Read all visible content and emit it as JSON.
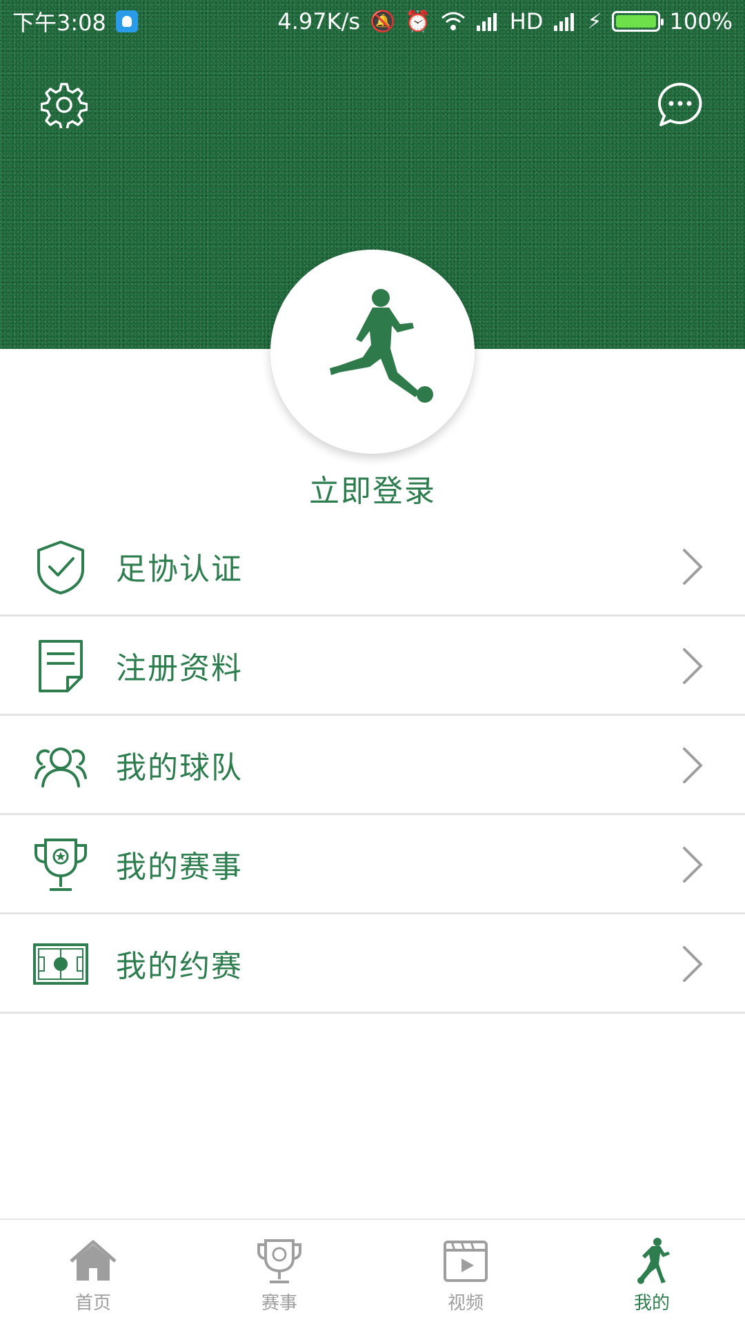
{
  "status_bar": {
    "time": "下午3:08",
    "net_speed": "4.97K/s",
    "network": "HD",
    "battery": "100%",
    "battery_level": 1.0
  },
  "header": {
    "settings_icon": "gear-icon",
    "message_icon": "chat-bubble-icon"
  },
  "profile": {
    "avatar_icon": "soccer-player-icon",
    "login_label": "立即登录"
  },
  "menu": {
    "items": [
      {
        "label": "足协认证",
        "icon": "shield-check-icon"
      },
      {
        "label": "注册资料",
        "icon": "document-icon"
      },
      {
        "label": "我的球队",
        "icon": "team-icon"
      },
      {
        "label": "我的赛事",
        "icon": "trophy-icon"
      },
      {
        "label": "我的约赛",
        "icon": "pitch-icon"
      }
    ]
  },
  "tabbar": {
    "tabs": [
      {
        "label": "首页",
        "icon": "home-icon",
        "active": false
      },
      {
        "label": "赛事",
        "icon": "trophy-icon",
        "active": false
      },
      {
        "label": "视频",
        "icon": "video-icon",
        "active": false
      },
      {
        "label": "我的",
        "icon": "soccer-player-icon",
        "active": true
      }
    ]
  },
  "colors": {
    "accent": "#2e7d4f",
    "grass": "#1f6b3c",
    "inactive": "#9e9e9e",
    "divider": "#e3e3e3"
  }
}
